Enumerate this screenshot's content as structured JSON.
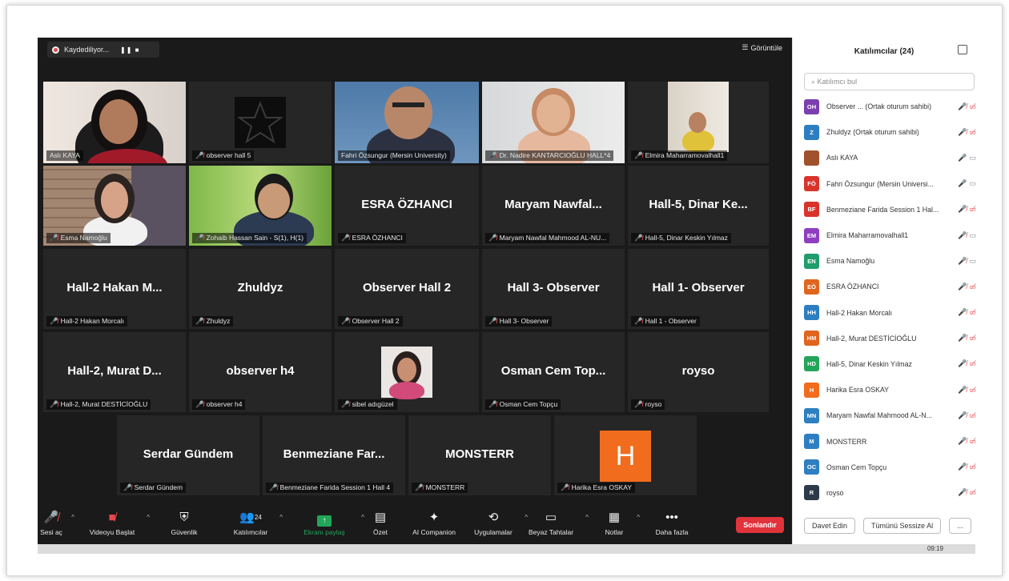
{
  "recording": {
    "label": "Kaydediliyor...",
    "controls": "❚❚  ■"
  },
  "view_button": {
    "label": "Görüntüle"
  },
  "tiles": [
    {
      "label": "Aslı KAYA",
      "muted": false
    },
    {
      "label": "observer hall 5",
      "muted": true
    },
    {
      "label": "Fahri Özsungur (Mersin University)",
      "muted": false
    },
    {
      "label": "Dr. Nadire KANTARCIOĞLU HALL*4",
      "muted": true
    },
    {
      "label": "Elmira Maharramovalhall1",
      "muted": true
    },
    {
      "label": "Esma Namoğlu",
      "muted": true
    },
    {
      "label": "Zohaib Hassan Sain - S(1), H(1)",
      "muted": true
    },
    {
      "name": "ESRA ÖZHANCI",
      "label": "ESRA ÖZHANCI",
      "muted": true
    },
    {
      "name": "Maryam  Nawfal...",
      "label": "Maryam Nawfal Mahmood AL-NU...",
      "muted": true
    },
    {
      "name": "Hall-5, Dinar Ke...",
      "label": "Hall-5, Dinar Keskin Yılmaz",
      "muted": true
    },
    {
      "name": "Hall-2 Hakan M...",
      "label": "Hall-2 Hakan Morcalı",
      "muted": true
    },
    {
      "name": "Zhuldyz",
      "label": "Zhuldyz",
      "muted": true
    },
    {
      "name": "Observer Hall 2",
      "label": "Observer Hall 2",
      "muted": true
    },
    {
      "name": "Hall 3- Observer",
      "label": "Hall 3- Observer",
      "muted": true
    },
    {
      "name": "Hall 1- Observer",
      "label": "Hall 1 - Observer",
      "muted": true
    },
    {
      "name": "Hall-2, Murat D...",
      "label": "Hall-2, Murat DESTİCİOĞLU",
      "muted": true
    },
    {
      "name": "observer h4",
      "label": "observer h4",
      "muted": true
    },
    {
      "label": "sibel adıgüzel",
      "muted": true
    },
    {
      "name": "Osman Cem Top...",
      "label": "Osman Cem Topçu",
      "muted": true
    },
    {
      "name": "roysо",
      "label": "roysо",
      "muted": true
    },
    {
      "name": "Serdar Gündem",
      "label": "Serdar Gündem",
      "muted": true
    },
    {
      "name": "Benmeziane  Far...",
      "label": "Benmeziane Farida Session 1 Hall 4",
      "muted": true
    },
    {
      "name": "MONSTERR",
      "label": "MONSTERR",
      "muted": true
    },
    {
      "label": "Harika Esra OSKAY",
      "muted": true,
      "initial": "H",
      "initial_color": "#f26c1d"
    }
  ],
  "toolbar": {
    "audio": "Sesi aç",
    "video": "Videoyu Başlat",
    "security": "Güvenlik",
    "participants": "Katılımcılar",
    "participants_count": "24",
    "share": "Ekranı paylaş",
    "summary": "Özet",
    "companion": "AI Companion",
    "apps": "Uygulamalar",
    "whiteboard": "Beyaz Tahtalar",
    "notes": "Notlar",
    "more": "Daha fazla",
    "end": "Sonlandır"
  },
  "panel": {
    "title": "Katılımcılar (24)",
    "search_placeholder": "Katılımcı bul",
    "participants": [
      {
        "initials": "OH",
        "color": "#7b3fb0",
        "name": "Observer ... (Ortak oturum sahibi)",
        "mic": "muted",
        "cam": "off"
      },
      {
        "initials": "Z",
        "color": "#2d7fc1",
        "name": "Zhuldyz (Ortak oturum sahibi)",
        "mic": "muted",
        "cam": "off"
      },
      {
        "initials": "",
        "color": "#a0522d",
        "name": "Aslı KAYA",
        "mic": "on",
        "cam": "on"
      },
      {
        "initials": "FÖ",
        "color": "#d9342b",
        "name": "Fahri Özsungur (Mersin Universi...",
        "mic": "on",
        "cam": "on"
      },
      {
        "initials": "BF",
        "color": "#d9342b",
        "name": "Benmeziane Farida Session 1 Hal...",
        "mic": "muted",
        "cam": "off"
      },
      {
        "initials": "EM",
        "color": "#8e3fc0",
        "name": "Elmira Maharramovalhall1",
        "mic": "muted",
        "cam": "on"
      },
      {
        "initials": "EN",
        "color": "#1f9d6b",
        "name": "Esma Namoğlu",
        "mic": "muted",
        "cam": "on"
      },
      {
        "initials": "EÖ",
        "color": "#e0651e",
        "name": "ESRA ÖZHANCI",
        "mic": "muted",
        "cam": "off"
      },
      {
        "initials": "HH",
        "color": "#2d7fc1",
        "name": "Hall-2 Hakan Morcalı",
        "mic": "muted",
        "cam": "off"
      },
      {
        "initials": "HM",
        "color": "#e0651e",
        "name": "Hall-2, Murat DESTİCİOĞLU",
        "mic": "muted",
        "cam": "off"
      },
      {
        "initials": "HD",
        "color": "#23a559",
        "name": "Hall-5, Dinar Keskin Yılmaz",
        "mic": "muted",
        "cam": "off"
      },
      {
        "initials": "H",
        "color": "#f26c1d",
        "name": "Harika Esra OSKAY",
        "mic": "muted",
        "cam": "off"
      },
      {
        "initials": "MN",
        "color": "#2d7fc1",
        "name": "Maryam Nawfal Mahmood AL-N...",
        "mic": "muted",
        "cam": "off"
      },
      {
        "initials": "M",
        "color": "#2d7fc1",
        "name": "MONSTERR",
        "mic": "muted",
        "cam": "off"
      },
      {
        "initials": "OC",
        "color": "#2d7fc1",
        "name": "Osman Cem Topçu",
        "mic": "muted",
        "cam": "off"
      },
      {
        "initials": "R",
        "color": "#2d3a4a",
        "name": "roysо",
        "mic": "muted",
        "cam": "off"
      }
    ],
    "invite": "Davet Edin",
    "mute_all": "Tümünü Sessize Al",
    "more": "..."
  },
  "taskbar": {
    "time": "09:19"
  }
}
